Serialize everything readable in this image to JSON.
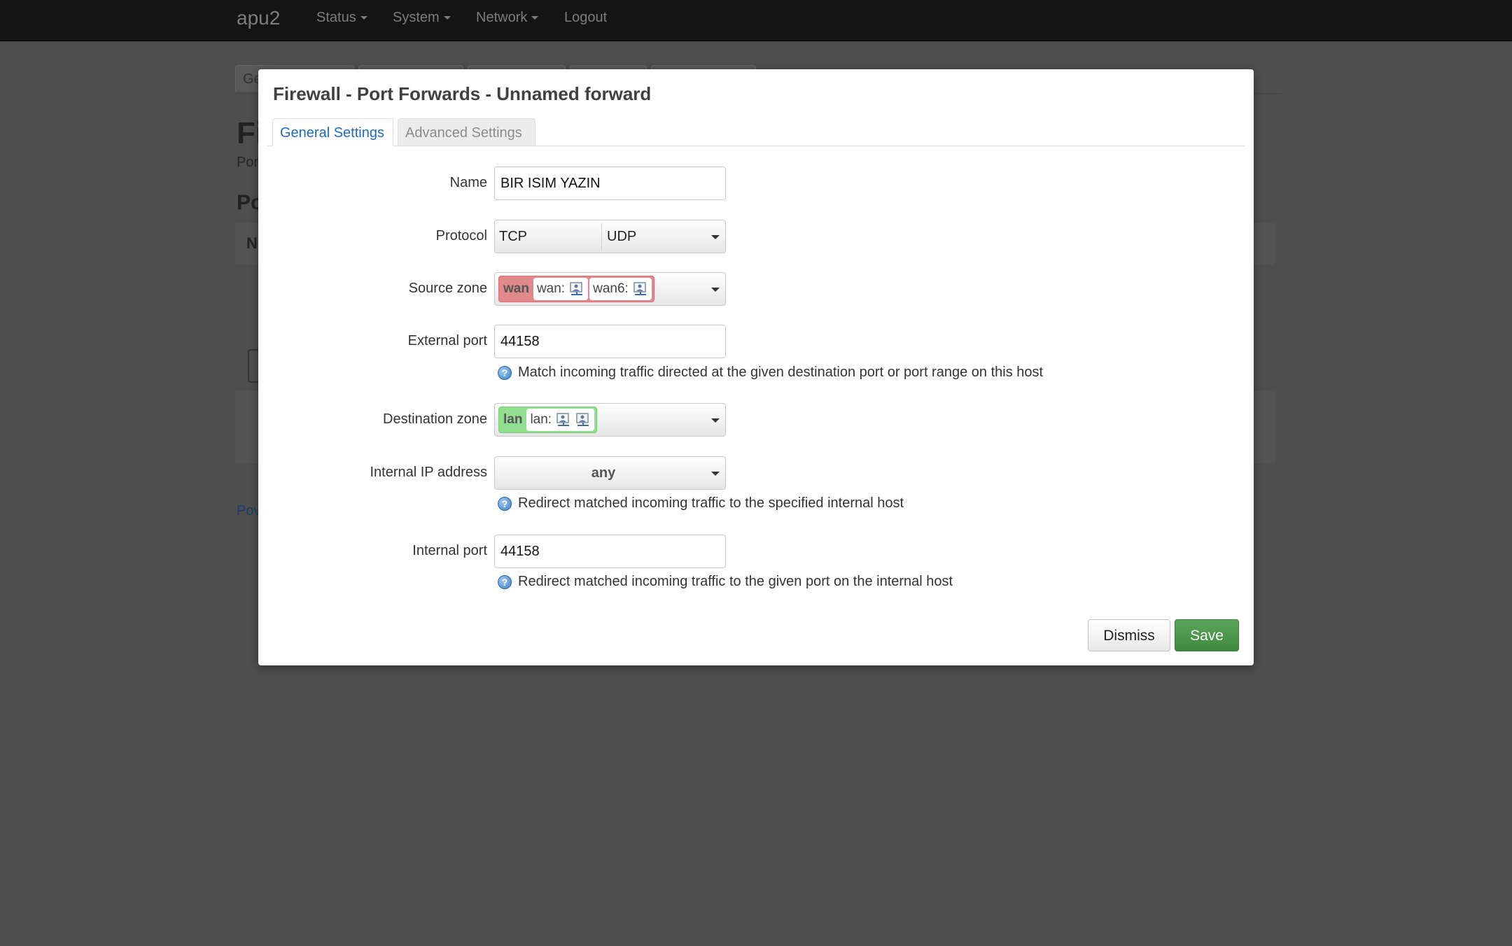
{
  "navbar": {
    "brand": "apu2",
    "items": [
      {
        "label": "Status",
        "dropdown": true
      },
      {
        "label": "System",
        "dropdown": true
      },
      {
        "label": "Network",
        "dropdown": true
      },
      {
        "label": "Logout",
        "dropdown": false
      }
    ]
  },
  "background_page": {
    "first_tab_fragment": "Ge",
    "title_fragment": "Fi",
    "subtitle_fragment": "Por",
    "section_fragment": "Po",
    "table_header_fragment": "N",
    "footer_fragment": "Pov"
  },
  "modal": {
    "title": "Firewall - Port Forwards - Unnamed forward",
    "tabs": [
      {
        "label": "General Settings",
        "active": true
      },
      {
        "label": "Advanced Settings",
        "active": false
      }
    ],
    "fields": {
      "name": {
        "label": "Name",
        "value": "BIR ISIM YAZIN"
      },
      "protocol": {
        "label": "Protocol",
        "options": [
          "TCP",
          "UDP"
        ]
      },
      "source_zone": {
        "label": "Source zone",
        "zone": "wan",
        "networks": [
          "wan:",
          "wan6:"
        ],
        "color": "#e0888a"
      },
      "external_port": {
        "label": "External port",
        "value": "44158",
        "help": "Match incoming traffic directed at the given destination port or port range on this host"
      },
      "destination_zone": {
        "label": "Destination zone",
        "zone": "lan",
        "networks": [
          "lan:"
        ],
        "color": "#90e090"
      },
      "internal_ip": {
        "label": "Internal IP address",
        "value": "any",
        "help": "Redirect matched incoming traffic to the specified internal host"
      },
      "internal_port": {
        "label": "Internal port",
        "value": "44158",
        "help": "Redirect matched incoming traffic to the given port on the internal host"
      }
    },
    "buttons": {
      "dismiss": "Dismiss",
      "save": "Save"
    },
    "icons": {
      "help": "help-circle-icon",
      "network": "network-interface-icon",
      "dropdown": "chevron-down-icon"
    },
    "help_glyph": "?"
  },
  "colors": {
    "navbar_bg": "#141414",
    "overlay_bg": "#4e4e4e",
    "accent_link": "#1f6bbf",
    "save_green": "#4a944a"
  }
}
